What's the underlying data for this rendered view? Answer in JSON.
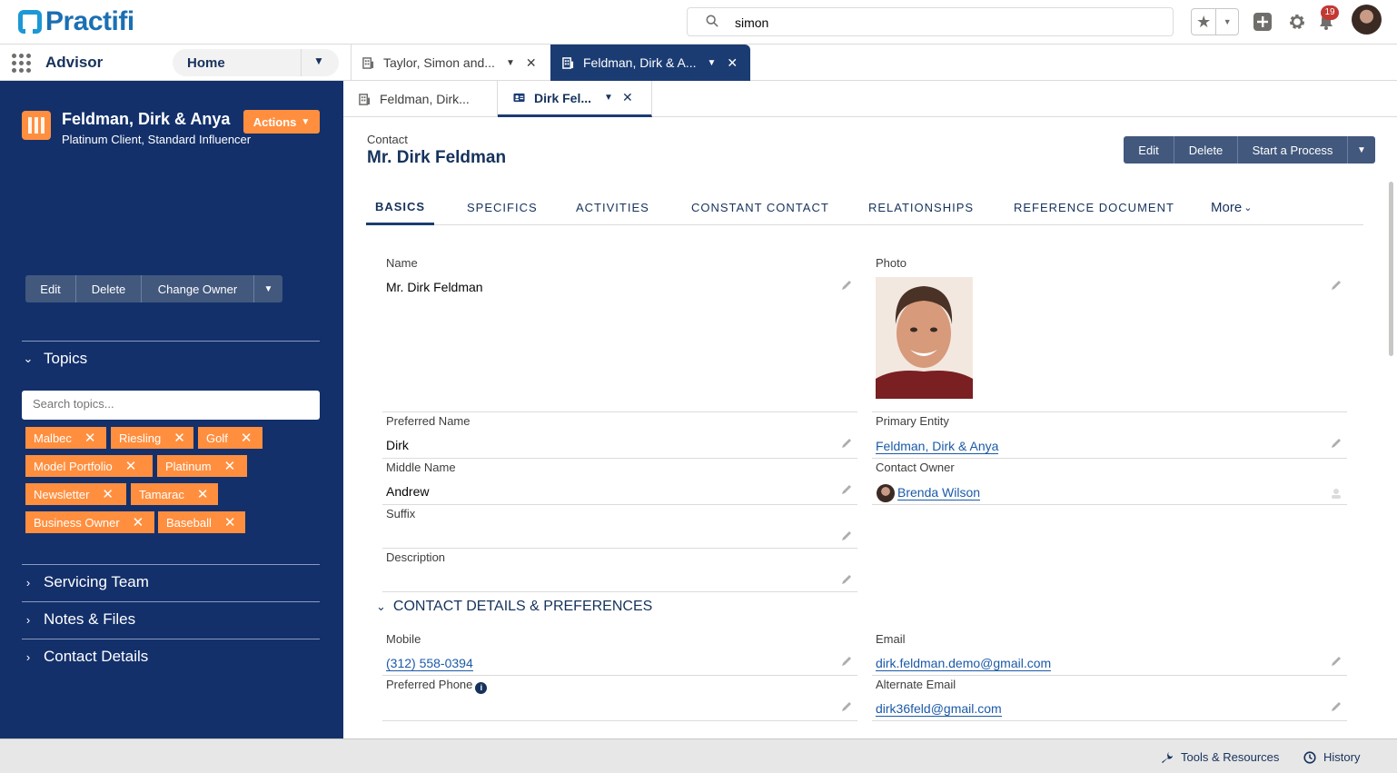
{
  "header": {
    "logo_text": "Practifi",
    "search_value": "simon",
    "notification_count": "19"
  },
  "nav": {
    "app_name": "Advisor",
    "home_label": "Home",
    "tabs": [
      {
        "label": "Taylor, Simon and..."
      },
      {
        "label": "Feldman, Dirk & A..."
      }
    ]
  },
  "sidebar": {
    "account_name": "Feldman, Dirk & Anya",
    "actions_label": "Actions",
    "account_subtitle": "Platinum Client, Standard Influencer",
    "buttons": {
      "edit": "Edit",
      "delete": "Delete",
      "change_owner": "Change Owner"
    },
    "topics_title": "Topics",
    "topics_search_placeholder": "Search topics...",
    "topics": [
      "Malbec",
      "Riesling",
      "Golf",
      "Model Portfolio",
      "Platinum",
      "Newsletter",
      "Tamarac",
      "Business Owner",
      "Baseball"
    ],
    "sections": [
      "Servicing Team",
      "Notes & Files",
      "Contact Details"
    ]
  },
  "subtabs": [
    {
      "label": "Feldman, Dirk..."
    },
    {
      "label": "Dirk Fel..."
    }
  ],
  "record": {
    "type": "Contact",
    "name": "Mr. Dirk Feldman",
    "buttons": {
      "edit": "Edit",
      "delete": "Delete",
      "start_process": "Start a Process"
    },
    "tabs": [
      "BASICS",
      "SPECIFICS",
      "ACTIVITIES",
      "CONSTANT CONTACT",
      "RELATIONSHIPS",
      "REFERENCE DOCUMENT"
    ],
    "more_label": "More",
    "fields": {
      "name_label": "Name",
      "name_value": "Mr. Dirk Feldman",
      "photo_label": "Photo",
      "preferred_name_label": "Preferred Name",
      "preferred_name_value": "Dirk",
      "primary_entity_label": "Primary Entity",
      "primary_entity_value": "Feldman, Dirk & Anya",
      "middle_name_label": "Middle Name",
      "middle_name_value": "Andrew",
      "contact_owner_label": "Contact Owner",
      "contact_owner_value": "Brenda Wilson",
      "suffix_label": "Suffix",
      "description_label": "Description"
    },
    "section2_title": "CONTACT DETAILS & PREFERENCES",
    "contact_fields": {
      "mobile_label": "Mobile",
      "mobile_value": "(312) 558-0394",
      "email_label": "Email",
      "email_value": "dirk.feldman.demo@gmail.com",
      "preferred_phone_label": "Preferred Phone",
      "alt_email_label": "Alternate Email",
      "alt_email_value": "dirk36feld@gmail.com"
    }
  },
  "footer": {
    "tools": "Tools & Resources",
    "history": "History"
  },
  "colors": {
    "sidebar": "#13306b",
    "accent_orange": "#ff8f3f",
    "button": "#42587d",
    "brand": "#1b6fb3"
  }
}
